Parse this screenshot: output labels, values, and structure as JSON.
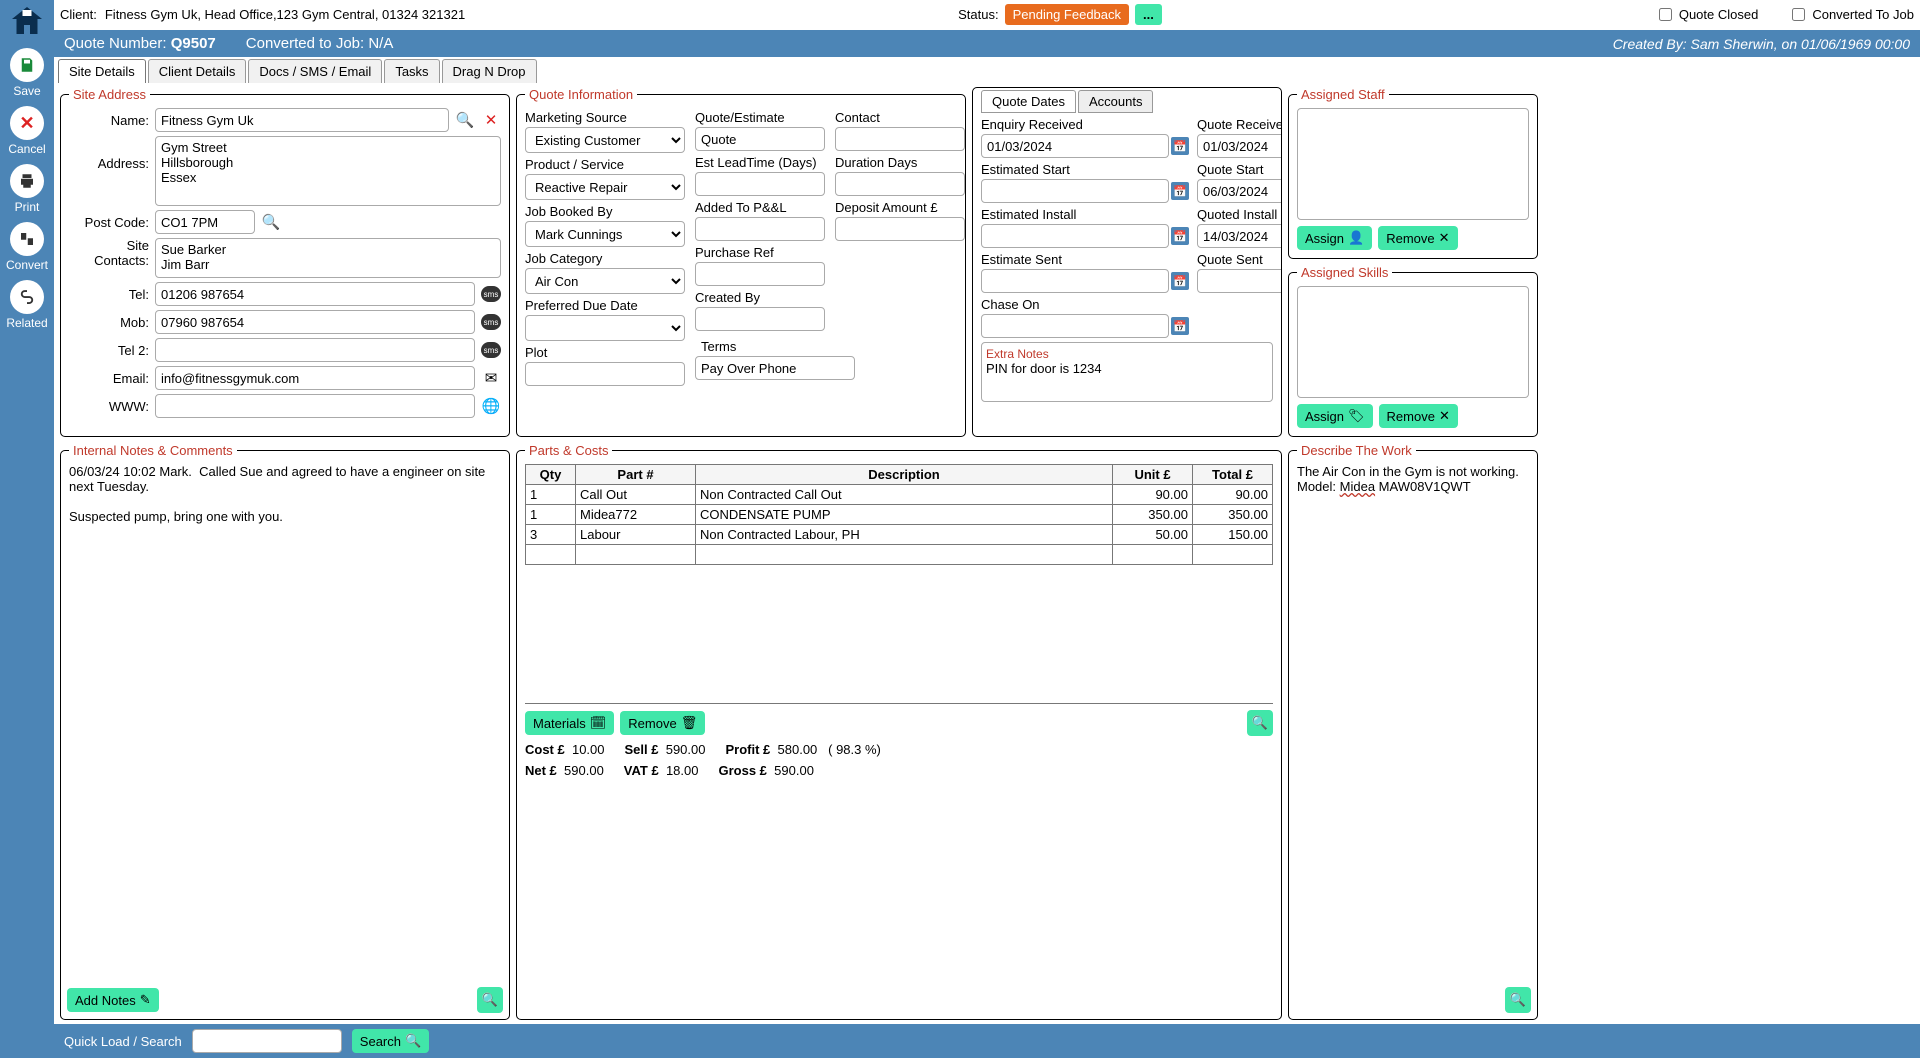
{
  "header": {
    "client_label": "Client:",
    "client_value": "Fitness Gym Uk, Head Office,123 Gym Central, 01324 321321",
    "status_label": "Status:",
    "status_value": "Pending Feedback",
    "dots": "...",
    "quote_closed_label": "Quote Closed",
    "converted_job_label": "Converted To Job"
  },
  "bluebar": {
    "quote_label": "Quote Number:",
    "quote_value": "Q9507",
    "converted_label": "Converted to Job:",
    "converted_value": "N/A",
    "created_by": "Created By: Sam Sherwin, on 01/06/1969 00:00"
  },
  "leftbar": {
    "save": "Save",
    "cancel": "Cancel",
    "print": "Print",
    "convert": "Convert",
    "related": "Related"
  },
  "tabs": [
    "Site Details",
    "Client Details",
    "Docs / SMS / Email",
    "Tasks",
    "Drag N Drop"
  ],
  "site": {
    "legend": "Site Address",
    "name_lbl": "Name:",
    "name": "Fitness Gym Uk",
    "addr_lbl": "Address:",
    "addr": "Gym Street\nHillsborough\nEssex",
    "post_lbl": "Post Code:",
    "post": "CO1 7PM",
    "contacts_lbl": "Site Contacts:",
    "contacts": "Sue Barker\nJim Barr",
    "tel_lbl": "Tel:",
    "tel": "01206 987654",
    "mob_lbl": "Mob:",
    "mob": "07960 987654",
    "tel2_lbl": "Tel 2:",
    "tel2": "",
    "email_lbl": "Email:",
    "email": "info@fitnessgymuk.com",
    "www_lbl": "WWW:",
    "www": ""
  },
  "qi": {
    "legend": "Quote Information",
    "marketing_lbl": "Marketing Source",
    "marketing": "Existing Customer",
    "quote_lbl": "Quote/Estimate",
    "quote": "Quote",
    "contact_lbl": "Contact",
    "contact": "",
    "product_lbl": "Product / Service",
    "product": "Reactive Repair",
    "lead_lbl": "Est LeadTime (Days)",
    "lead": "",
    "duration_lbl": "Duration Days",
    "duration": "",
    "jobbook_lbl": "Job Booked By",
    "jobbook": "Mark Cunnings",
    "pandl_lbl": "Added To P&&L",
    "pandl": "",
    "deposit_lbl": "Deposit Amount £",
    "deposit": "",
    "jobcat_lbl": "Job Category",
    "jobcat": "Air Con",
    "purchase_lbl": "Purchase Ref",
    "purchase": "",
    "prefdue_lbl": "Preferred Due Date",
    "prefdue": "",
    "created_lbl": "Created By",
    "created": "",
    "plot_lbl": "Plot",
    "plot": "",
    "terms_lbl": "Terms",
    "terms": "Pay Over Phone"
  },
  "dates": {
    "tab_qd": "Quote Dates",
    "tab_acc": "Accounts",
    "enq_r_lbl": "Enquiry Received",
    "enq_r": "01/03/2024",
    "quote_r_lbl": "Quote Received",
    "quote_r": "01/03/2024",
    "est_start_lbl": "Estimated Start",
    "est_start": "",
    "quote_start_lbl": "Quote Start",
    "quote_start": "06/03/2024",
    "est_install_lbl": "Estimated Install",
    "est_install": "",
    "quoted_install_lbl": "Quoted Install",
    "quoted_install": "14/03/2024",
    "est_sent_lbl": "Estimate Sent",
    "est_sent": "",
    "quote_sent_lbl": "Quote Sent",
    "quote_sent": "",
    "chase_lbl": "Chase On",
    "chase": "",
    "extra_lbl": "Extra Notes",
    "extra": "PIN for door is 1234"
  },
  "assigned": {
    "staff_legend": "Assigned Staff",
    "skills_legend": "Assigned Skills",
    "assign": "Assign",
    "remove": "Remove"
  },
  "notes": {
    "legend": "Internal Notes & Comments",
    "text": "06/03/24 10:02 Mark.  Called Sue and agreed to have a engineer on site next Tuesday.\n\nSuspected pump, bring one with you.",
    "add_btn": "Add Notes"
  },
  "parts": {
    "legend": "Parts & Costs",
    "headers": {
      "qty": "Qty",
      "part": "Part #",
      "desc": "Description",
      "unit": "Unit £",
      "total": "Total £"
    },
    "rows": [
      {
        "qty": "1",
        "part": "Call Out",
        "desc": "Non Contracted Call Out",
        "unit": "90.00",
        "total": "90.00"
      },
      {
        "qty": "1",
        "part": "Midea772",
        "desc": "CONDENSATE PUMP",
        "unit": "350.00",
        "total": "350.00"
      },
      {
        "qty": "3",
        "part": "Labour",
        "desc": "Non Contracted Labour, PH",
        "unit": "50.00",
        "total": "150.00"
      }
    ],
    "materials_btn": "Materials",
    "remove_btn": "Remove",
    "cost_lbl": "Cost £",
    "cost": "10.00",
    "sell_lbl": "Sell £",
    "sell": "590.00",
    "profit_lbl": "Profit £",
    "profit": "580.00",
    "pct": "( 98.3 %)",
    "net_lbl": "Net £",
    "net": "590.00",
    "vat_lbl": "VAT £",
    "vat": "18.00",
    "gross_lbl": "Gross £",
    "gross": "590.00"
  },
  "describe": {
    "legend": "Describe The Work",
    "line1": "The Air Con in the Gym is not working.",
    "line2a": "Model: ",
    "line2b": "Midea",
    "line2c": " MAW08V1QWT"
  },
  "footer": {
    "quick_lbl": "Quick Load / Search",
    "search_btn": "Search"
  }
}
